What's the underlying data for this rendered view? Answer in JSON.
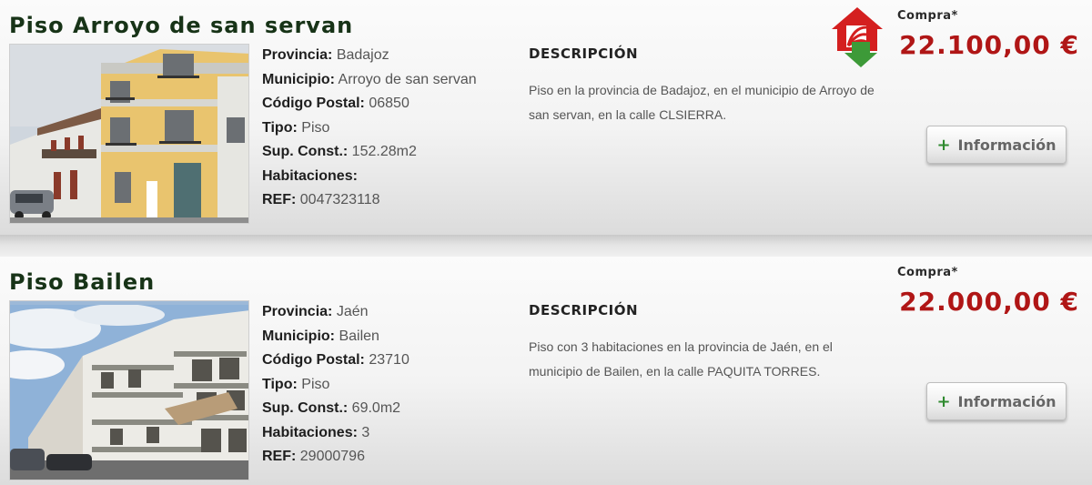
{
  "listings": [
    {
      "title": "Piso Arroyo de san servan",
      "fields": [
        {
          "label": "Provincia:",
          "value": "Badajoz"
        },
        {
          "label": "Municipio:",
          "value": "Arroyo de san servan"
        },
        {
          "label": "Código Postal:",
          "value": "06850"
        },
        {
          "label": "Tipo:",
          "value": "Piso"
        },
        {
          "label": "Sup. Const.:",
          "value": "152.28m2"
        },
        {
          "label": "Habitaciones:",
          "value": ""
        },
        {
          "label": "REF:",
          "value": "0047323118"
        }
      ],
      "description_heading": "DESCRIPCIÓN",
      "description": "Piso en la provincia de Badajoz, en el municipio de Arroyo de san servan, en la calle CLSIERRA.",
      "price_label": "Compra*",
      "price": "22.100,00 €",
      "info_button_plus": "+",
      "info_button": "Información",
      "logo_icon": "red-house-green-arrow-icon"
    },
    {
      "title": "Piso Bailen",
      "fields": [
        {
          "label": "Provincia:",
          "value": "Jaén"
        },
        {
          "label": "Municipio:",
          "value": "Bailen"
        },
        {
          "label": "Código Postal:",
          "value": "23710"
        },
        {
          "label": "Tipo:",
          "value": "Piso"
        },
        {
          "label": "Sup. Const.:",
          "value": "69.0m2"
        },
        {
          "label": "Habitaciones:",
          "value": "3"
        },
        {
          "label": "REF:",
          "value": "29000796"
        }
      ],
      "description_heading": "DESCRIPCIÓN",
      "description": "Piso con 3 habitaciones en la provincia de Jaén, en el municipio de Bailen, en la calle PAQUITA TORRES.",
      "price_label": "Compra*",
      "price": "22.000,00 €",
      "info_button_plus": "+",
      "info_button": "Información"
    }
  ],
  "colors": {
    "title": "#173317",
    "price": "#b01616",
    "plus": "#2f8a2f"
  }
}
